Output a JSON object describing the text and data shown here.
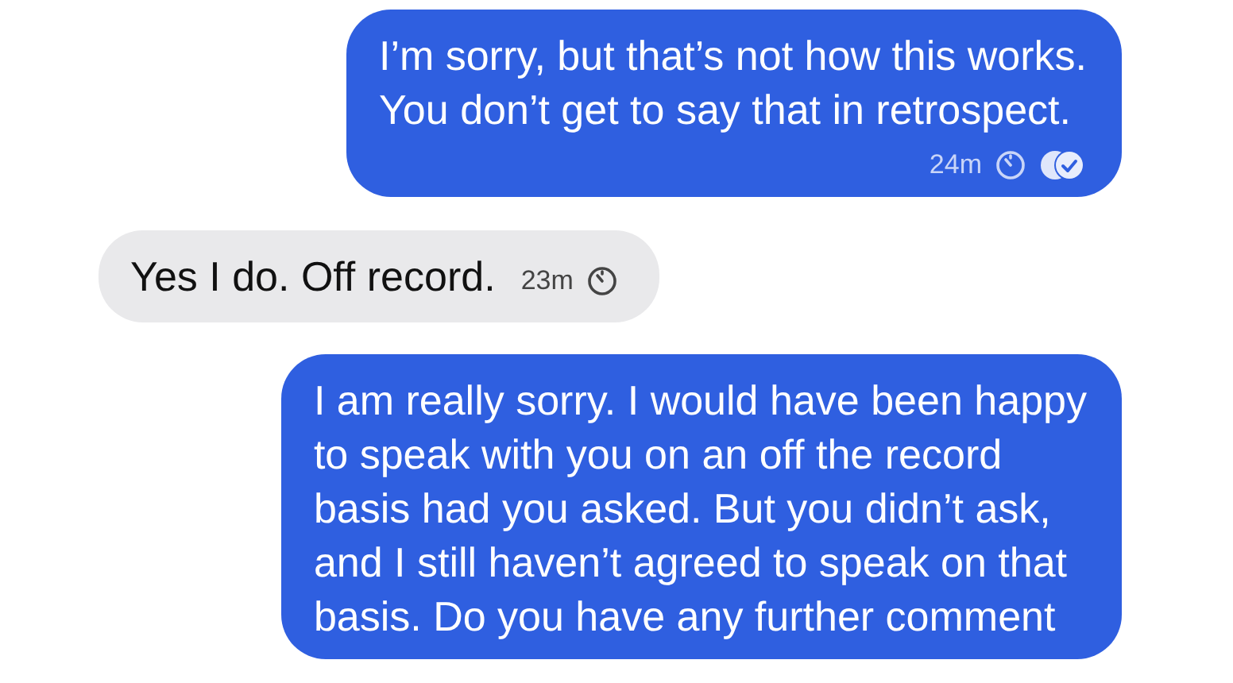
{
  "messages": [
    {
      "kind": "sent",
      "lines": [
        "I’m sorry, but that’s not how this works.",
        "You don’t get to say that in retrospect."
      ],
      "time": "24m",
      "timer": true,
      "read": true
    },
    {
      "kind": "received",
      "lines": [
        "Yes I do. Off record."
      ],
      "time": "23m",
      "timer": true,
      "read": false
    },
    {
      "kind": "sent",
      "lines": [
        "I am really sorry. I would have been happy",
        "to speak with you on an off the record",
        "basis had you asked. But you didn’t ask,",
        "and I still haven’t agreed to speak on that",
        "basis. Do you have any further comment"
      ]
    }
  ]
}
